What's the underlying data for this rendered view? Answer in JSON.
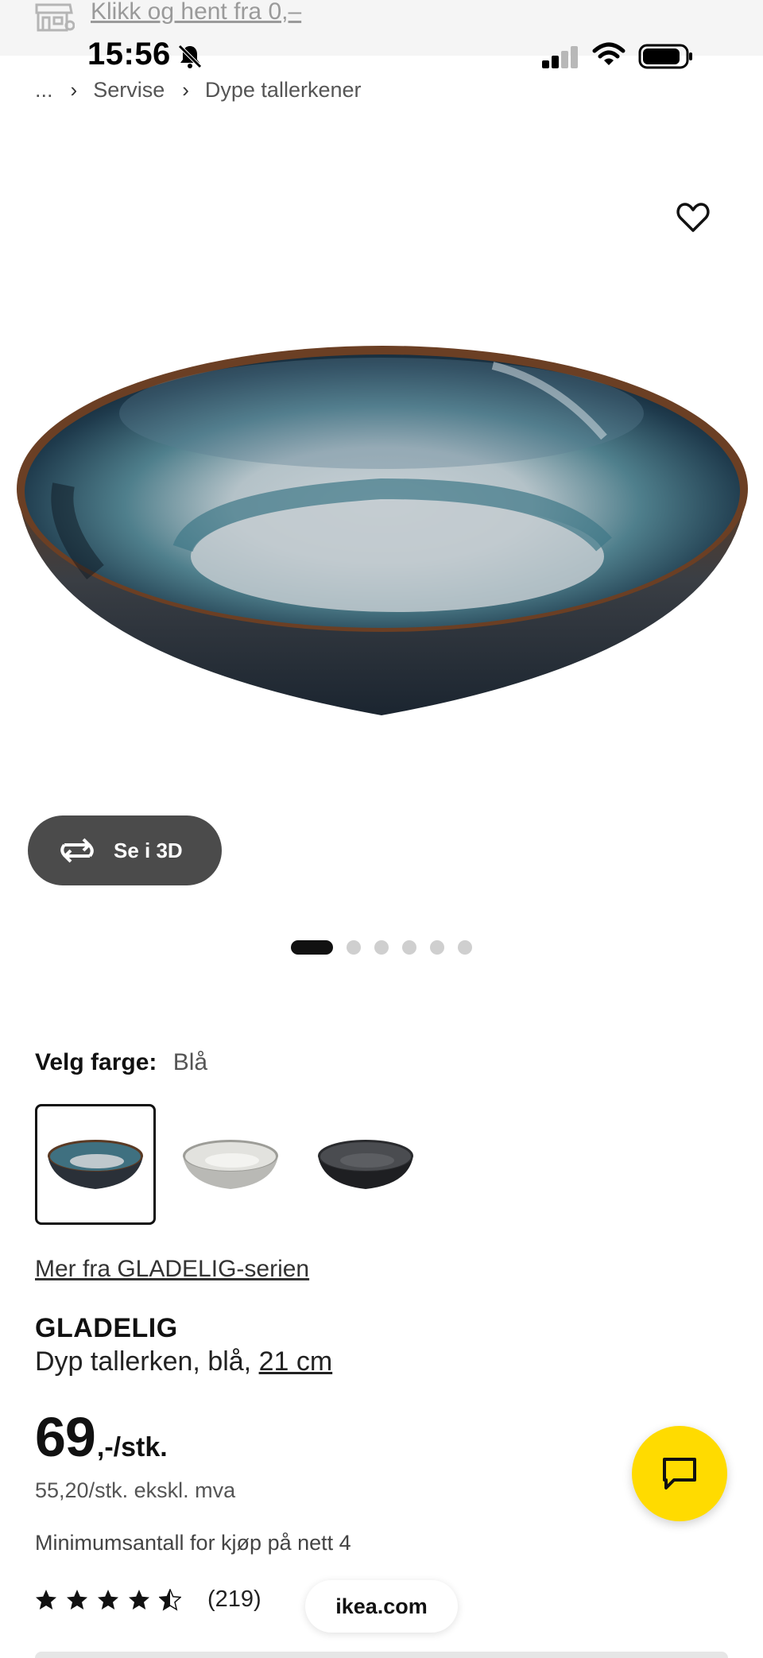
{
  "banner": {
    "text": "Klikk og hent fra 0,–",
    "icon": "store-icon"
  },
  "status_bar": {
    "time": "15:56",
    "icons": [
      "bell-slash-icon",
      "signal-icon",
      "wifi-icon",
      "battery-icon"
    ]
  },
  "breadcrumb": {
    "ellipsis": "...",
    "items": [
      "Servise",
      "Dype tallerkener"
    ]
  },
  "favorite": {
    "icon": "heart-outline-icon"
  },
  "gallery": {
    "view_3d_label": "Se i 3D",
    "slide_count": 6,
    "active_slide": 1
  },
  "color_picker": {
    "label": "Velg farge:",
    "selected": "Blå",
    "options": [
      "Blå",
      "Grå",
      "Sort"
    ]
  },
  "series_link": "Mer fra GLADELIG-serien",
  "product": {
    "name": "GLADELIG",
    "description": "Dyp tallerken, blå, ",
    "size": "21 cm",
    "price_main": "69",
    "price_suffix": ",-/stk.",
    "price_ex_vat": "55,20/stk. ekskl. mva",
    "min_qty": "Minimumsantall for kjøp på nett 4",
    "rating_value": 4.5,
    "rating_count": "(219)"
  },
  "site_pill": "ikea.com",
  "colors": {
    "chat_button": "#ffdb00",
    "accent_dark": "#111111",
    "view3d_bg": "#4b4b4b"
  }
}
